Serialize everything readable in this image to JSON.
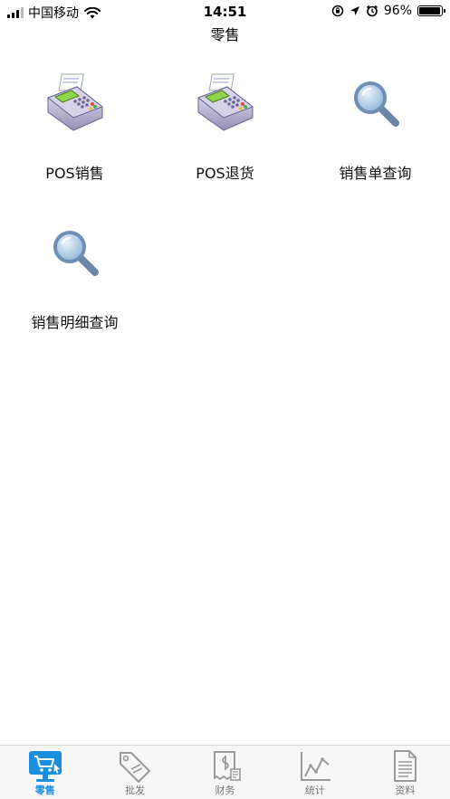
{
  "status_bar": {
    "carrier": "中国移动",
    "time": "14:51",
    "battery": "96%",
    "battery_level": 0.96
  },
  "header": {
    "title": "零售"
  },
  "menu": [
    {
      "label": "POS销售",
      "icon": "pos-terminal-icon"
    },
    {
      "label": "POS退货",
      "icon": "pos-terminal-icon"
    },
    {
      "label": "销售单查询",
      "icon": "magnifier-icon"
    },
    {
      "label": "销售明细查询",
      "icon": "magnifier-icon"
    }
  ],
  "tabs": [
    {
      "label": "零售",
      "icon": "cart-monitor-icon",
      "active": true
    },
    {
      "label": "批发",
      "icon": "sale-tag-icon",
      "active": false
    },
    {
      "label": "财务",
      "icon": "finance-document-icon",
      "active": false
    },
    {
      "label": "统计",
      "icon": "line-chart-icon",
      "active": false
    },
    {
      "label": "资料",
      "icon": "document-icon",
      "active": false
    }
  ],
  "colors": {
    "accent": "#1a8fe0",
    "inactive": "#9a9a9a",
    "tab_bg": "#f7f7f7"
  }
}
